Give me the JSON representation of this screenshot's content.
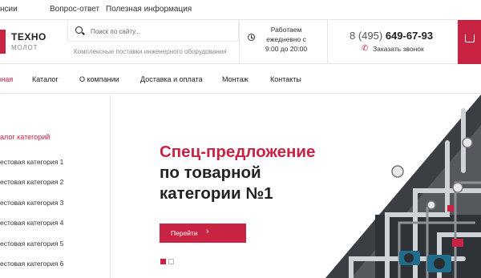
{
  "topbar": {
    "links": [
      "нсии",
      "Вопрос-ответ",
      "Полезная информация"
    ]
  },
  "logo": {
    "name": "ТЕХНО",
    "sub": "МОЛОТ"
  },
  "search": {
    "placeholder": "Поиск по сайту...",
    "tagline": "Комплексные поставки инженерного оборудования"
  },
  "hours": {
    "lines": [
      "Работаем",
      "ежедневно с",
      "9:00 до 20:00"
    ]
  },
  "contact": {
    "phone_prefix": "8 (495)",
    "phone_number": "649-67-93",
    "callback_label": "Заказать звонок"
  },
  "nav": {
    "items": [
      "Главная",
      "Каталог",
      "О компании",
      "Доставка и оплата",
      "Монтаж",
      "Контакты"
    ]
  },
  "sidebar": {
    "title": "алог категорий",
    "items": [
      "естовая категория 1",
      "естовая категория 2",
      "естовая категория 3",
      "естовая категория 4",
      "естовая категория 5",
      "естовая категория 6"
    ]
  },
  "hero": {
    "title_red": "Спец-предложение",
    "title_lines": [
      "по товарной",
      "категории №1"
    ],
    "button_label": "Перейти",
    "slides_total": 2,
    "active_slide": 1
  },
  "colors": {
    "accent": "#c92343",
    "text": "#222222"
  }
}
